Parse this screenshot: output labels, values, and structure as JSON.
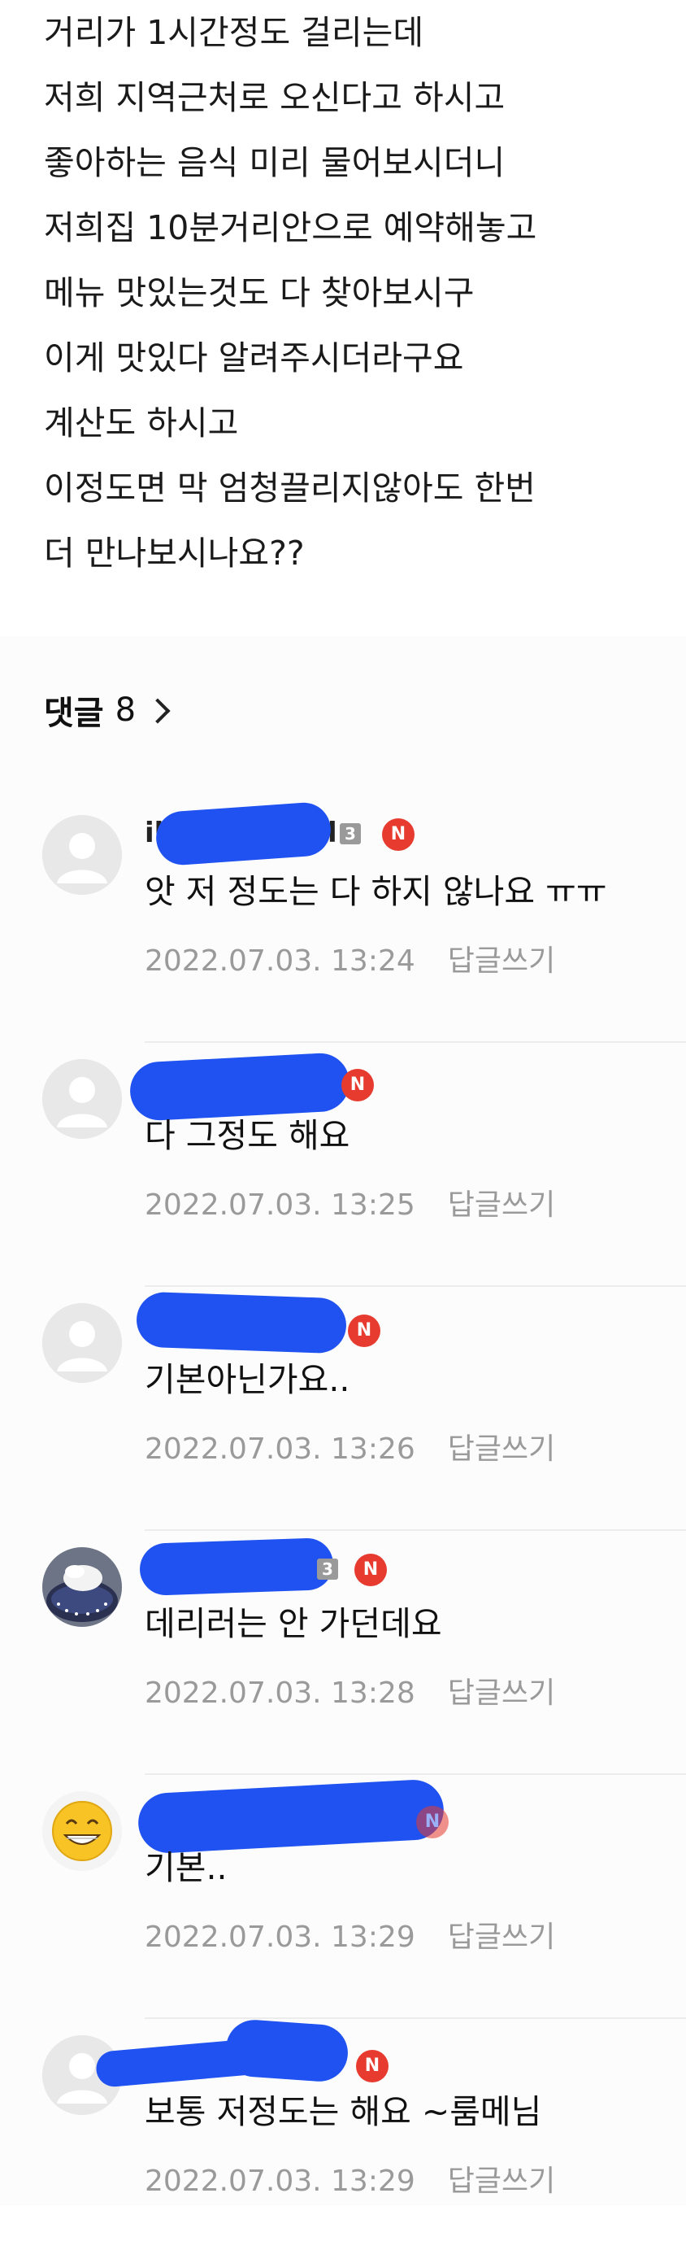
{
  "post": {
    "lines": [
      "거리가 1시간정도 걸리는데",
      "저희 지역근처로 오신다고 하시고",
      "좋아하는 음식 미리 물어보시더니",
      "저희집 10분거리안으로 예약해놓고",
      "메뉴 맛있는것도 다 찾아보시구",
      "이게 맛있다 알려주시더라구요",
      "계산도 하시고",
      "이정도면 막 엄청끌리지않아도 한번",
      "더 만나보시나요??"
    ]
  },
  "comments_section": {
    "title": "댓글",
    "count": "8",
    "items": [
      {
        "name_visible": "il",
        "name_suffix": "l",
        "level": "3",
        "badge": "N",
        "avatar": "default-avatar",
        "text": "앗 저 정도는 다 하지 않나요 ㅠㅠ",
        "date": "2022.07.03. 13:24",
        "reply_label": "답글쓰기"
      },
      {
        "name_visible": "",
        "name_suffix": "",
        "level": "",
        "badge": "N",
        "avatar": "default-avatar",
        "text": "다 그정도 해요",
        "date": "2022.07.03. 13:25",
        "reply_label": "답글쓰기"
      },
      {
        "name_visible": "",
        "name_suffix": "",
        "level": "",
        "badge": "N",
        "avatar": "default-avatar",
        "text": "기본아닌가요..",
        "date": "2022.07.03. 13:26",
        "reply_label": "답글쓰기"
      },
      {
        "name_visible": "",
        "name_suffix": "",
        "level": "3",
        "badge": "N",
        "avatar": "photo-avatar",
        "text": "데리러는 안 가던데요",
        "date": "2022.07.03. 13:28",
        "reply_label": "답글쓰기"
      },
      {
        "name_visible": "",
        "name_suffix": "",
        "level": "",
        "badge": "N",
        "avatar": "emoji-avatar",
        "text": "기본..",
        "date": "2022.07.03. 13:29",
        "reply_label": "답글쓰기"
      },
      {
        "name_visible": "",
        "name_suffix": "",
        "level": "",
        "badge": "N",
        "avatar": "default-avatar",
        "text": "보통 저정도는 해요 ~룸메님",
        "date": "2022.07.03. 13:29",
        "reply_label": "답글쓰기"
      }
    ]
  },
  "colors": {
    "redaction": "#1f52f0",
    "new_badge": "#e63b2e",
    "meta_text": "#9a9a9a"
  }
}
